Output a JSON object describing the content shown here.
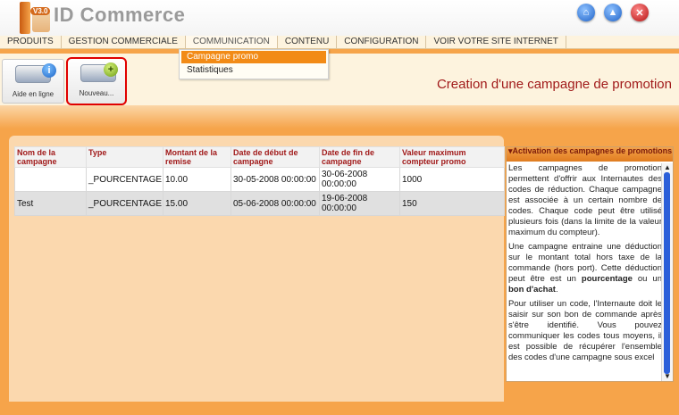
{
  "app": {
    "logo_version": "V3.0",
    "title": "ID Commerce"
  },
  "menu": {
    "items": [
      "PRODUITS",
      "GESTION COMMERCIALE",
      "COMMUNICATION",
      "CONTENU",
      "CONFIGURATION",
      "VOIR VOTRE SITE INTERNET"
    ],
    "active": "COMMUNICATION"
  },
  "dropdown": {
    "items": [
      "Campagne promo",
      "Statistiques"
    ],
    "selected": "Campagne promo"
  },
  "toolbar": {
    "help_label": "Aide en ligne",
    "new_label": "Nouveau..."
  },
  "page": {
    "title": "Creation d'une campagne de promotion"
  },
  "table": {
    "headers": [
      "Nom de la campagne",
      "Type",
      "Montant de la remise",
      "Date de début de campagne",
      "Date de fin de campagne",
      "Valeur maximum compteur promo"
    ],
    "rows": [
      [
        "",
        "_POURCENTAGE",
        "10.00",
        "30-05-2008 00:00:00",
        "30-06-2008 00:00:00",
        "1000"
      ],
      [
        "Test",
        "_POURCENTAGE",
        "15.00",
        "05-06-2008 00:00:00",
        "19-06-2008 00:00:00",
        "150"
      ]
    ]
  },
  "side": {
    "heading": "Activation des campagnes de promotions",
    "p1": "Les campagnes de promotion permettent d'offrir aux Internautes des codes de réduction. Chaque campagne est associée à un certain nombre de codes. Chaque code peut être utilisé plusieurs fois (dans la limite de la valeur maximum du compteur).",
    "p2_a": "Une campagne entraine une déduction sur le montant total hors taxe de la commande (hors port). Cette déduction peut être est un ",
    "p2_b": "pourcentage",
    "p2_c": " ou un ",
    "p2_d": "bon d'achat",
    "p2_e": ".",
    "p3": "Pour utiliser un code, l'Internaute doit le saisir sur son bon de commande après s'être identifié. Vous pouvez communiquer les codes tous moyens, il est possible de récupérer l'ensemble des codes d'une campagne sous excel"
  },
  "colors": {
    "accent": "#f28b16",
    "title": "#a11a1a",
    "background": "#f6a44a",
    "highlight": "#e00000"
  },
  "icons": {
    "home": "home-icon",
    "up": "up-arrow-icon",
    "close": "close-icon",
    "help": "info-icon",
    "new": "plus-icon"
  }
}
